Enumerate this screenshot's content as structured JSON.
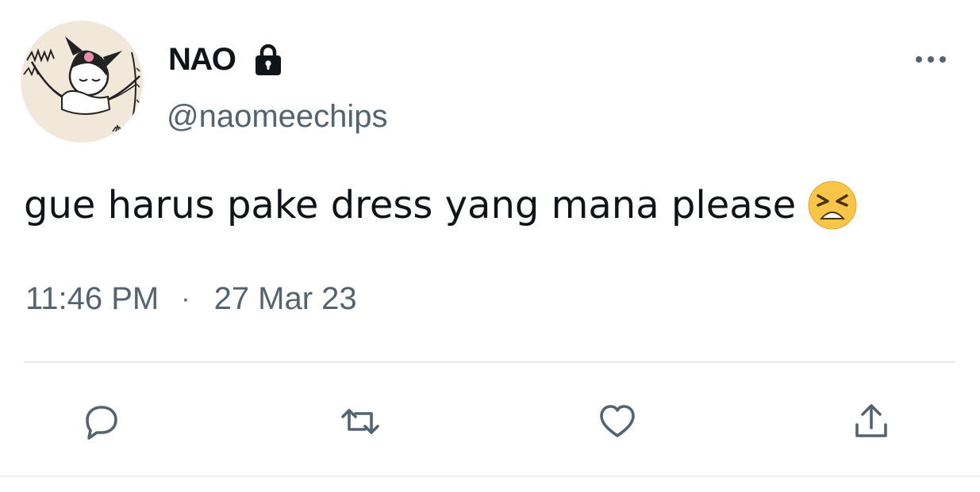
{
  "user": {
    "display_name": "NAO",
    "handle": "@naomeechips",
    "protected": true,
    "avatar_icon": "cartoon-character-in-hammock-avatar"
  },
  "tweet": {
    "text": "gue harus pake dress yang mana please",
    "emoji_icon": "tired-face-emoji",
    "time": "11:46 PM",
    "separator": "·",
    "date": "27 Mar 23"
  },
  "actions": {
    "reply_icon": "reply-icon",
    "retweet_icon": "retweet-icon",
    "like_icon": "heart-icon",
    "share_icon": "share-icon"
  },
  "colors": {
    "text_primary": "#0f1419",
    "text_secondary": "#536471",
    "divider": "#e6e9eb",
    "emoji_face": "#f7c548"
  }
}
